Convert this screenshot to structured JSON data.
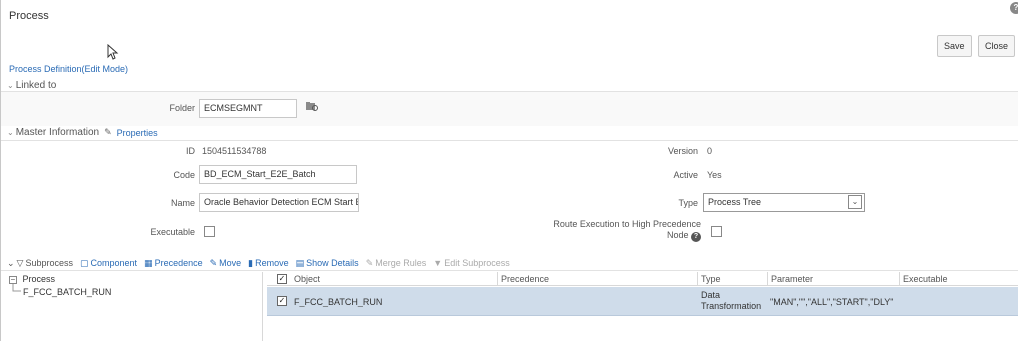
{
  "window": {
    "title": "Process"
  },
  "buttons": {
    "save": "Save",
    "close": "Close"
  },
  "edit_mode_link": "Process Definition(Edit Mode)",
  "linked_to": {
    "header": "Linked to",
    "folder_label": "Folder",
    "folder_value": "ECMSEGMNT"
  },
  "master": {
    "header": "Master Information",
    "properties_link": "Properties",
    "id_label": "ID",
    "id_value": "1504511534788",
    "version_label": "Version",
    "version_value": "0",
    "code_label": "Code",
    "code_value": "BD_ECM_Start_E2E_Batch",
    "active_label": "Active",
    "active_value": "Yes",
    "name_label": "Name",
    "name_value": "Oracle Behavior Detection ECM Start E",
    "type_label": "Type",
    "type_value": "Process Tree",
    "executable_label": "Executable",
    "route_label_1": "Route Execution to High Precedence",
    "route_label_2": "Node"
  },
  "toolbar": {
    "subprocess": "Subprocess",
    "component": "Component",
    "precedence": "Precedence",
    "move": "Move",
    "remove": "Remove",
    "show_details": "Show Details",
    "merge_rules": "Merge Rules",
    "edit_subprocess": "Edit Subprocess"
  },
  "tree": {
    "root": "Process",
    "child": "F_FCC_BATCH_RUN"
  },
  "grid": {
    "columns": [
      "Object",
      "Precedence",
      "Type",
      "Parameter",
      "Executable"
    ],
    "rows": [
      {
        "object": "F_FCC_BATCH_RUN",
        "precedence": "",
        "type_line1": "Data",
        "type_line2": "Transformation",
        "parameter": "\"MAN\",\"\",\"ALL\",\"START\",\"DLY\"",
        "executable": ""
      }
    ]
  }
}
